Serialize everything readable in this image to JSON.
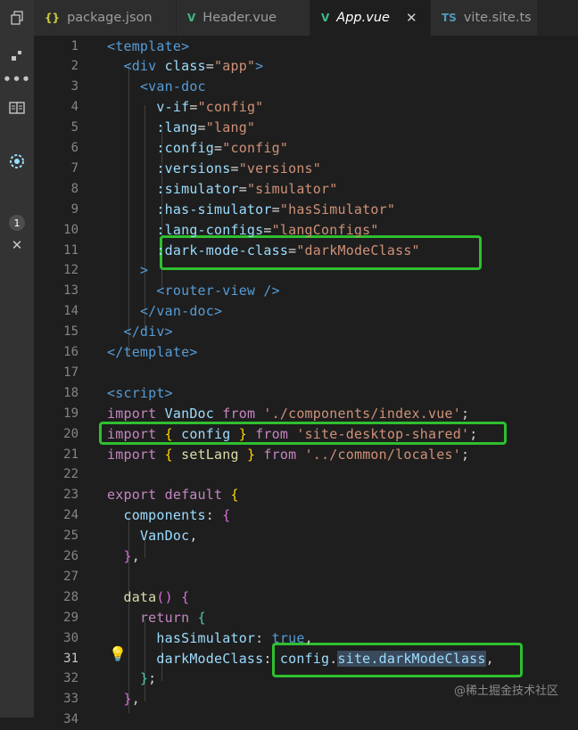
{
  "tabs": [
    {
      "label": "package.json",
      "icon": "{}",
      "icon_color": "#cbcb41",
      "active": false
    },
    {
      "label": "Header.vue",
      "icon": "V",
      "icon_color": "#41b883",
      "active": false
    },
    {
      "label": "App.vue",
      "icon": "V",
      "icon_color": "#41b883",
      "active": true,
      "close": "✕"
    },
    {
      "label": "vite.site.ts",
      "icon": "TS",
      "icon_color": "#519aba",
      "active": false
    }
  ],
  "activity_bar": {
    "items": [
      "copy-icon",
      "extensions-icon",
      "more-icon",
      "book-icon",
      "settings-sync-icon"
    ],
    "badge": "1",
    "close": "✕"
  },
  "editor": {
    "current_line": 31,
    "lines": [
      {
        "n": "1",
        "tokens": [
          [
            "tag",
            "<template>"
          ]
        ]
      },
      {
        "n": "2",
        "tokens": [
          [
            "plain",
            "  "
          ],
          [
            "tag",
            "<div "
          ],
          [
            "attr",
            "class"
          ],
          [
            "plain",
            "="
          ],
          [
            "str",
            "\"app\""
          ],
          [
            "tag",
            ">"
          ]
        ]
      },
      {
        "n": "3",
        "tokens": [
          [
            "plain",
            "    "
          ],
          [
            "tag",
            "<van-doc"
          ]
        ]
      },
      {
        "n": "4",
        "tokens": [
          [
            "plain",
            "      "
          ],
          [
            "attr",
            "v-if"
          ],
          [
            "plain",
            "="
          ],
          [
            "str",
            "\"config\""
          ]
        ]
      },
      {
        "n": "5",
        "tokens": [
          [
            "plain",
            "      "
          ],
          [
            "attr",
            ":lang"
          ],
          [
            "plain",
            "="
          ],
          [
            "str",
            "\"lang\""
          ]
        ]
      },
      {
        "n": "6",
        "tokens": [
          [
            "plain",
            "      "
          ],
          [
            "attr",
            ":config"
          ],
          [
            "plain",
            "="
          ],
          [
            "str",
            "\"config\""
          ]
        ]
      },
      {
        "n": "7",
        "tokens": [
          [
            "plain",
            "      "
          ],
          [
            "attr",
            ":versions"
          ],
          [
            "plain",
            "="
          ],
          [
            "str",
            "\"versions\""
          ]
        ]
      },
      {
        "n": "8",
        "tokens": [
          [
            "plain",
            "      "
          ],
          [
            "attr",
            ":simulator"
          ],
          [
            "plain",
            "="
          ],
          [
            "str",
            "\"simulator\""
          ]
        ]
      },
      {
        "n": "9",
        "tokens": [
          [
            "plain",
            "      "
          ],
          [
            "attr",
            ":has-simulator"
          ],
          [
            "plain",
            "="
          ],
          [
            "str",
            "\"hasSimulator\""
          ]
        ]
      },
      {
        "n": "10",
        "tokens": [
          [
            "plain",
            "      "
          ],
          [
            "attr",
            ":lang-configs"
          ],
          [
            "plain",
            "="
          ],
          [
            "str",
            "\"langConfigs\""
          ]
        ]
      },
      {
        "n": "11",
        "tokens": [
          [
            "plain",
            "      "
          ],
          [
            "attr",
            ":dark-mode-class"
          ],
          [
            "plain",
            "="
          ],
          [
            "str",
            "\"darkModeClass\""
          ]
        ]
      },
      {
        "n": "12",
        "tokens": [
          [
            "plain",
            "    "
          ],
          [
            "tag",
            ">"
          ]
        ]
      },
      {
        "n": "13",
        "tokens": [
          [
            "plain",
            "      "
          ],
          [
            "tag",
            "<router-view />"
          ]
        ]
      },
      {
        "n": "14",
        "tokens": [
          [
            "plain",
            "    "
          ],
          [
            "tag",
            "</van-doc>"
          ]
        ]
      },
      {
        "n": "15",
        "tokens": [
          [
            "plain",
            "  "
          ],
          [
            "tag",
            "</div>"
          ]
        ]
      },
      {
        "n": "16",
        "tokens": [
          [
            "tag",
            "</template>"
          ]
        ]
      },
      {
        "n": "17",
        "tokens": []
      },
      {
        "n": "18",
        "tokens": [
          [
            "tag",
            "<script>"
          ]
        ]
      },
      {
        "n": "19",
        "tokens": [
          [
            "kw",
            "import "
          ],
          [
            "var",
            "VanDoc "
          ],
          [
            "kw",
            "from "
          ],
          [
            "str",
            "'./components/index.vue'"
          ],
          [
            "plain",
            ";"
          ]
        ]
      },
      {
        "n": "20",
        "tokens": [
          [
            "kw",
            "import "
          ],
          [
            "brace",
            "{ "
          ],
          [
            "var",
            "config "
          ],
          [
            "brace",
            "} "
          ],
          [
            "kw",
            "from "
          ],
          [
            "str",
            "'site-desktop-shared'"
          ],
          [
            "plain",
            ";"
          ]
        ]
      },
      {
        "n": "21",
        "tokens": [
          [
            "kw",
            "import "
          ],
          [
            "brace",
            "{ "
          ],
          [
            "fn",
            "setLang "
          ],
          [
            "brace",
            "} "
          ],
          [
            "kw",
            "from "
          ],
          [
            "str",
            "'../common/locales'"
          ],
          [
            "plain",
            ";"
          ]
        ]
      },
      {
        "n": "22",
        "tokens": []
      },
      {
        "n": "23",
        "tokens": [
          [
            "kw",
            "export default "
          ],
          [
            "brace",
            "{"
          ]
        ]
      },
      {
        "n": "24",
        "tokens": [
          [
            "plain",
            "  "
          ],
          [
            "var",
            "components"
          ],
          [
            "plain",
            ": "
          ],
          [
            "brace2",
            "{"
          ]
        ]
      },
      {
        "n": "25",
        "tokens": [
          [
            "plain",
            "    "
          ],
          [
            "var",
            "VanDoc"
          ],
          [
            "plain",
            ","
          ]
        ]
      },
      {
        "n": "26",
        "tokens": [
          [
            "plain",
            "  "
          ],
          [
            "brace2",
            "}"
          ],
          [
            "plain",
            ","
          ]
        ]
      },
      {
        "n": "27",
        "tokens": []
      },
      {
        "n": "28",
        "tokens": [
          [
            "plain",
            "  "
          ],
          [
            "fn",
            "data"
          ],
          [
            "brace2",
            "()"
          ],
          [
            "plain",
            " "
          ],
          [
            "brace2",
            "{"
          ]
        ]
      },
      {
        "n": "29",
        "tokens": [
          [
            "plain",
            "    "
          ],
          [
            "kw",
            "return "
          ],
          [
            "cls",
            "{"
          ]
        ]
      },
      {
        "n": "30",
        "tokens": [
          [
            "plain",
            "      "
          ],
          [
            "var",
            "hasSimulator"
          ],
          [
            "plain",
            ": "
          ],
          [
            "kw2",
            "true"
          ],
          [
            "plain",
            ","
          ]
        ]
      },
      {
        "n": "31",
        "tokens": [
          [
            "plain",
            "      "
          ],
          [
            "var",
            "darkModeClass"
          ],
          [
            "plain",
            ": "
          ],
          [
            "var",
            "config"
          ],
          [
            "plain",
            "."
          ],
          [
            "sel",
            "site.darkModeClass"
          ],
          [
            "plain",
            ","
          ]
        ]
      },
      {
        "n": "32",
        "tokens": [
          [
            "plain",
            "    "
          ],
          [
            "cls",
            "}"
          ],
          [
            "plain",
            ";"
          ]
        ]
      },
      {
        "n": "33",
        "tokens": [
          [
            "plain",
            "  "
          ],
          [
            "brace2",
            "}"
          ],
          [
            "plain",
            ","
          ]
        ]
      },
      {
        "n": "34",
        "tokens": []
      }
    ]
  },
  "watermark": "@稀土掘金技术社区"
}
